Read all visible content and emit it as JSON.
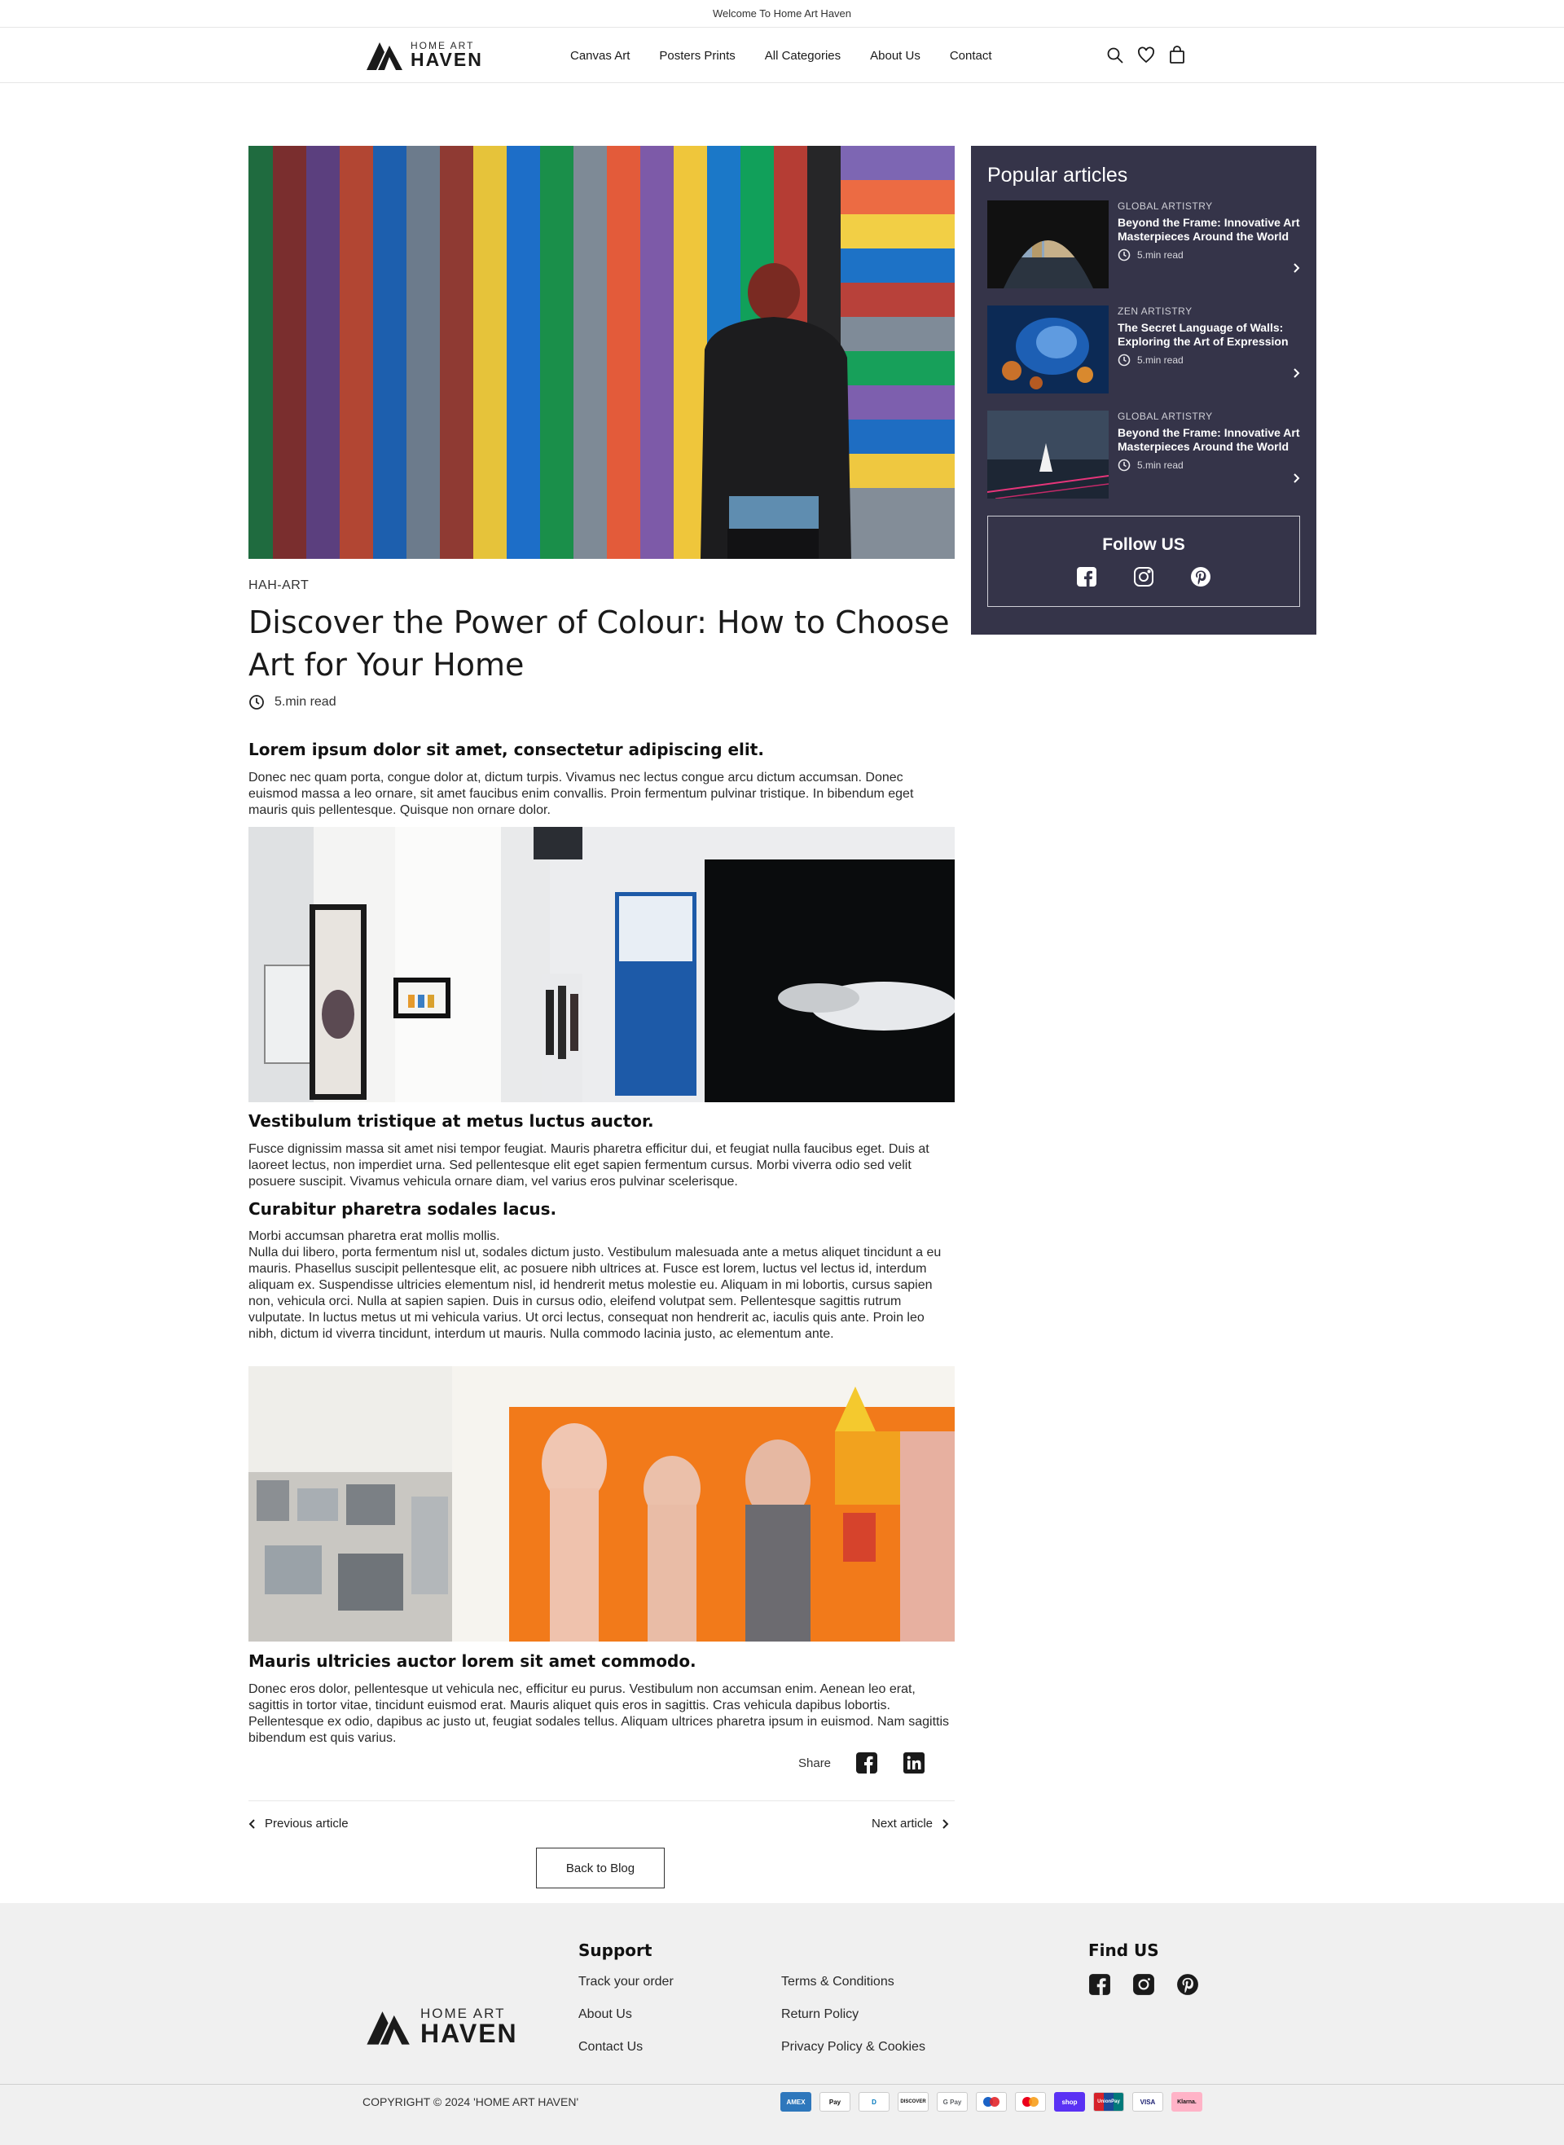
{
  "announcement": "Welcome To Home Art Haven",
  "brand": {
    "top": "HOME ART",
    "name": "HAVEN"
  },
  "nav": [
    "Canvas Art",
    "Posters Prints",
    "All Categories",
    "About Us",
    "Contact"
  ],
  "article": {
    "tag": "HAH-ART",
    "title": "Discover the Power of Colour: How to Choose Art for Your Home",
    "read_time": "5.min read",
    "sections": [
      {
        "heading": "Lorem ipsum dolor sit amet, consectetur adipiscing elit.",
        "body": "Donec nec quam porta, congue dolor at, dictum turpis. Vivamus nec lectus congue arcu dictum accumsan. Donec euismod massa a leo ornare, sit amet faucibus enim convallis. Proin fermentum pulvinar tristique. In bibendum eget mauris quis pellentesque. Quisque non ornare dolor."
      },
      {
        "heading": "Vestibulum tristique at metus luctus auctor.",
        "body": "Fusce dignissim massa sit amet nisi tempor feugiat. Mauris pharetra efficitur dui, et feugiat nulla faucibus eget. Duis at laoreet lectus, non imperdiet urna. Sed pellentesque elit eget sapien fermentum cursus. Morbi viverra odio sed velit posuere suscipit. Vivamus vehicula ornare diam, vel varius eros pulvinar scelerisque."
      },
      {
        "heading": "Curabitur pharetra sodales lacus.",
        "body_line1": "Morbi accumsan pharetra erat mollis mollis.",
        "body": "Nulla dui libero, porta fermentum nisl ut, sodales dictum justo. Vestibulum malesuada ante a metus aliquet tincidunt a eu mauris. Phasellus suscipit pellentesque elit, ac posuere nibh ultrices at. Fusce est lorem, luctus vel lectus id, interdum aliquam ex. Suspendisse ultricies elementum nisl, id hendrerit metus molestie eu. Aliquam in mi lobortis, cursus sapien non, vehicula orci. Nulla at sapien sapien. Duis in cursus odio, eleifend volutpat sem. Pellentesque sagittis rutrum vulputate. In luctus metus ut mi vehicula varius. Ut orci lectus, consequat non hendrerit ac, iaculis quis ante. Proin leo nibh, dictum id viverra tincidunt, interdum ut mauris. Nulla commodo lacinia justo, ac elementum ante."
      },
      {
        "heading": "Mauris ultricies auctor lorem sit amet commodo.",
        "body": "Donec eros dolor, pellentesque ut vehicula nec, efficitur eu purus. Vestibulum non accumsan enim. Aenean leo erat, sagittis in tortor vitae, tincidunt euismod erat. Mauris aliquet quis eros in sagittis. Cras vehicula dapibus lobortis. Pellentesque ex odio, dapibus ac justo ut, feugiat sodales tellus. Aliquam ultrices pharetra ipsum in euismod. Nam sagittis bibendum est quis varius."
      }
    ],
    "share_label": "Share",
    "prev_label": "Previous article",
    "next_label": "Next article",
    "back_label": "Back to Blog"
  },
  "sidebar": {
    "title": "Popular articles",
    "items": [
      {
        "category": "GLOBAL ARTISTRY",
        "title": "Beyond the Frame: Innovative Art Masterpieces Around the World",
        "read": "5.min read"
      },
      {
        "category": "ZEN ARTISTRY",
        "title": "The Secret Language of Walls: Exploring the Art of Expression",
        "read": "5.min read"
      },
      {
        "category": "GLOBAL ARTISTRY",
        "title": "Beyond the Frame: Innovative Art Masterpieces Around the World",
        "read": "5.min read"
      }
    ],
    "follow_title": "Follow US"
  },
  "footer": {
    "support_title": "Support",
    "links_col1": [
      "Track your order",
      "About Us",
      "Contact Us"
    ],
    "links_col2": [
      "Terms & Conditions",
      "Return Policy",
      "Privacy Policy & Cookies"
    ],
    "find_title": "Find US",
    "copyright": "COPYRIGHT © 2024 'HOME ART HAVEN'",
    "payments": [
      "AMEX",
      "Pay",
      "D",
      "DISCOVER",
      "G Pay",
      "MC",
      "MC",
      "shop",
      "UnionPay",
      "VISA",
      "Klarna."
    ]
  },
  "colors": {
    "sidebar_bg": "#353449",
    "footer_bg": "#f0f0f0",
    "accent_text": "#1a1a1a"
  }
}
